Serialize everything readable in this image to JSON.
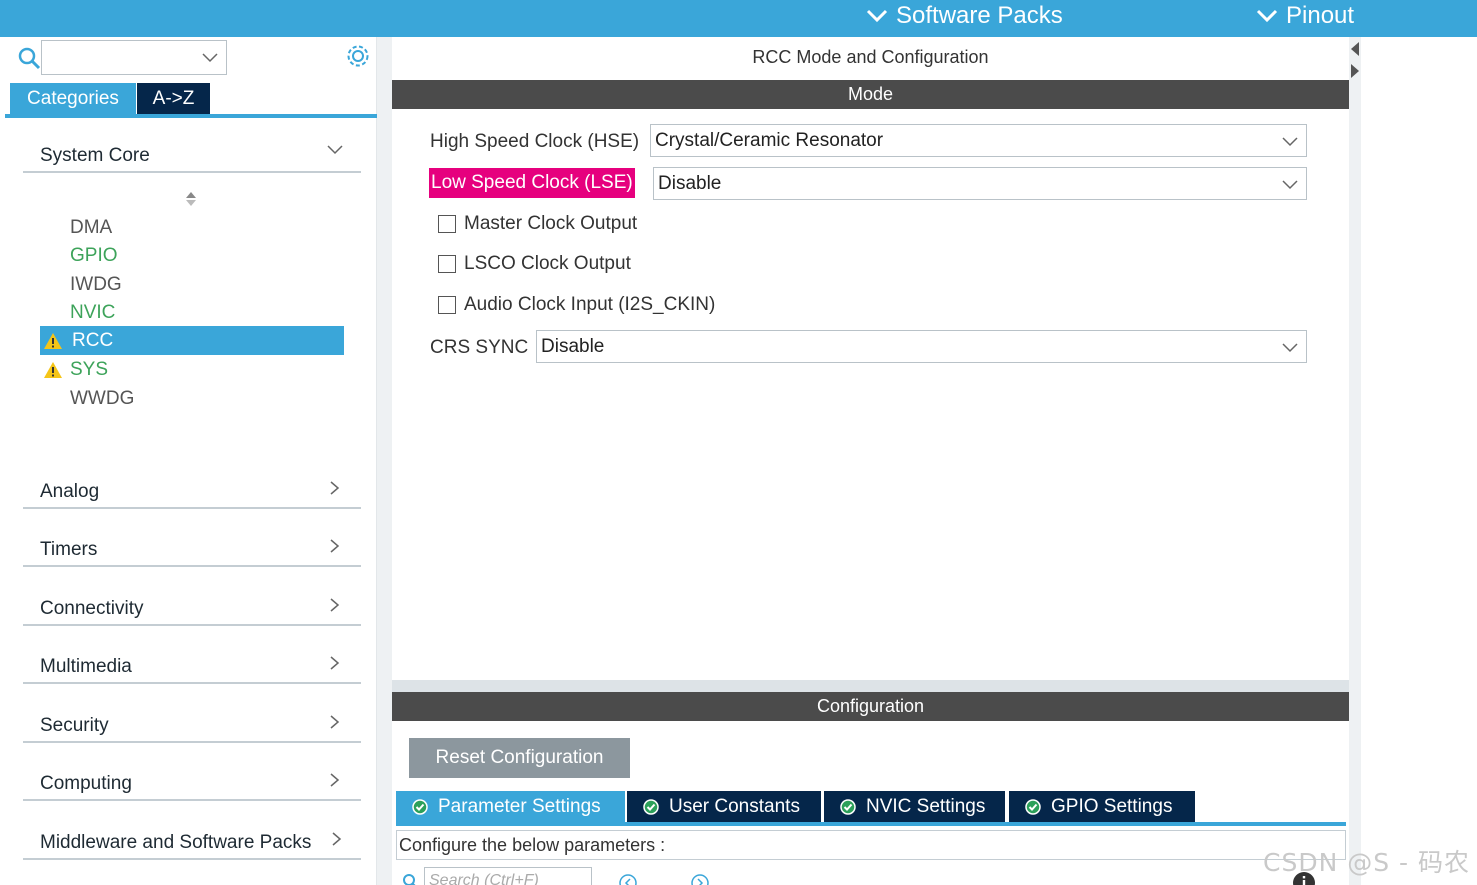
{
  "topbar": {
    "software_packs": "Software Packs",
    "pinout": "Pinout"
  },
  "left": {
    "tabs": {
      "categories": "Categories",
      "az": "A->Z"
    },
    "categories": [
      {
        "label": "System Core"
      },
      {
        "label": "Analog"
      },
      {
        "label": "Timers"
      },
      {
        "label": "Connectivity"
      },
      {
        "label": "Multimedia"
      },
      {
        "label": "Security"
      },
      {
        "label": "Computing"
      },
      {
        "label": "Middleware and Software Packs"
      }
    ],
    "system_core_items": [
      {
        "label": "DMA"
      },
      {
        "label": "GPIO"
      },
      {
        "label": "IWDG"
      },
      {
        "label": "NVIC"
      },
      {
        "label": "RCC"
      },
      {
        "label": "SYS"
      },
      {
        "label": "WWDG"
      }
    ]
  },
  "main": {
    "title": "RCC Mode and Configuration",
    "mode_header": "Mode",
    "hse": {
      "label": "High Speed Clock (HSE)",
      "value": "Crystal/Ceramic Resonator"
    },
    "lse": {
      "label": "Low Speed Clock (LSE)",
      "value": "Disable"
    },
    "checkboxes": [
      {
        "label": "Master Clock Output"
      },
      {
        "label": "LSCO Clock Output"
      },
      {
        "label": "Audio Clock Input (I2S_CKIN)"
      }
    ],
    "crs": {
      "label": "CRS SYNC",
      "value": "Disable"
    },
    "config_header": "Configuration",
    "reset_button": "Reset Configuration",
    "param_tabs": [
      {
        "label": "Parameter Settings"
      },
      {
        "label": "User Constants"
      },
      {
        "label": "NVIC Settings"
      },
      {
        "label": "GPIO Settings"
      }
    ],
    "config_hint": "Configure the below parameters :",
    "search_placeholder": "Search (Ctrl+F)"
  },
  "watermark": "CSDN @S - 码农",
  "colors": {
    "accent": "#3aa6d9",
    "dark_tab": "#05264a",
    "header_bar": "#4b4b4b",
    "highlight": "#e6007e",
    "green_item": "#3da35a",
    "warning": "#f5c518"
  }
}
